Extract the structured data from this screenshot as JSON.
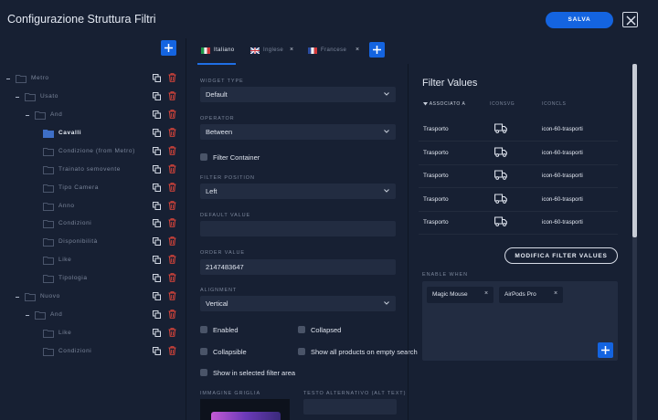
{
  "header": {
    "title": "Configurazione Struttura Filtri",
    "save_label": "SALVA"
  },
  "tree": {
    "items": [
      {
        "label": "Metro",
        "selected": false
      },
      {
        "label": "Usato",
        "selected": false
      },
      {
        "label": "And",
        "selected": false
      },
      {
        "label": "Cavalli",
        "selected": true
      },
      {
        "label": "Condizione (from Metro)",
        "selected": false
      },
      {
        "label": "Trainato semovente",
        "selected": false
      },
      {
        "label": "Tipo Camera",
        "selected": false
      },
      {
        "label": "Anno",
        "selected": false
      },
      {
        "label": "Condizioni",
        "selected": false
      },
      {
        "label": "Disponibilità",
        "selected": false
      },
      {
        "label": "Like",
        "selected": false
      },
      {
        "label": "Tipologia",
        "selected": false
      },
      {
        "label": "Nuovo",
        "selected": false
      },
      {
        "label": "And",
        "selected": false
      },
      {
        "label": "Like",
        "selected": false
      },
      {
        "label": "Condizioni",
        "selected": false
      }
    ]
  },
  "tabs": [
    {
      "label": "Italiano",
      "active": true,
      "closable": false,
      "flag": "flag-italy-icon"
    },
    {
      "label": "Inglese",
      "active": false,
      "closable": true,
      "flag": "flag-uk-icon"
    },
    {
      "label": "Francese",
      "active": false,
      "closable": true,
      "flag": "flag-france-icon"
    }
  ],
  "form": {
    "widget_type_label": "WIDGET TYPE",
    "widget_type_value": "Default",
    "operator_label": "OPERATOR",
    "operator_value": "Between",
    "filter_container_label": "Filter Container",
    "filter_position_label": "FILTER POSITION",
    "filter_position_value": "Left",
    "default_value_label": "DEFAULT VALUE",
    "default_value_value": "",
    "order_value_label": "ORDER VALUE",
    "order_value_value": "2147483647",
    "alignment_label": "ALIGNMENT",
    "alignment_value": "Vertical",
    "enabled_label": "Enabled",
    "collapsed_label": "Collapsed",
    "collapsible_label": "Collapsible",
    "show_all_label": "Show all products on empty search",
    "show_selected_label": "Show in selected filter area",
    "immagine_label": "IMMAGINE GRIGLIA",
    "alt_text_label": "TESTO ALTERNATIVO (ALT TEXT)"
  },
  "filter_values": {
    "title": "Filter Values",
    "col_associated": "ASSOCIATO A",
    "col_iconsvg": "ICONSVG",
    "col_iconcls": "ICONCLS",
    "rows": [
      {
        "associato": "Trasporto",
        "icon": "truck-icon",
        "iconcls": "icon-60-trasporti"
      },
      {
        "associato": "Trasporto",
        "icon": "truck-icon",
        "iconcls": "icon-60-trasporti"
      },
      {
        "associato": "Trasporto",
        "icon": "truck-icon",
        "iconcls": "icon-60-trasporti"
      },
      {
        "associato": "Trasporto",
        "icon": "truck-icon",
        "iconcls": "icon-60-trasporti"
      },
      {
        "associato": "Trasporto",
        "icon": "truck-icon",
        "iconcls": "icon-60-trasporti"
      }
    ],
    "modify_label": "MODIFICA FILTER VALUES"
  },
  "enable_when": {
    "label": "ENABLE WHEN",
    "chips": [
      "Magic Mouse",
      "AirPods Pro"
    ]
  },
  "colors": {
    "accent": "#1464e0",
    "background": "#172033",
    "field": "#222c41",
    "delete": "#e0453a"
  }
}
